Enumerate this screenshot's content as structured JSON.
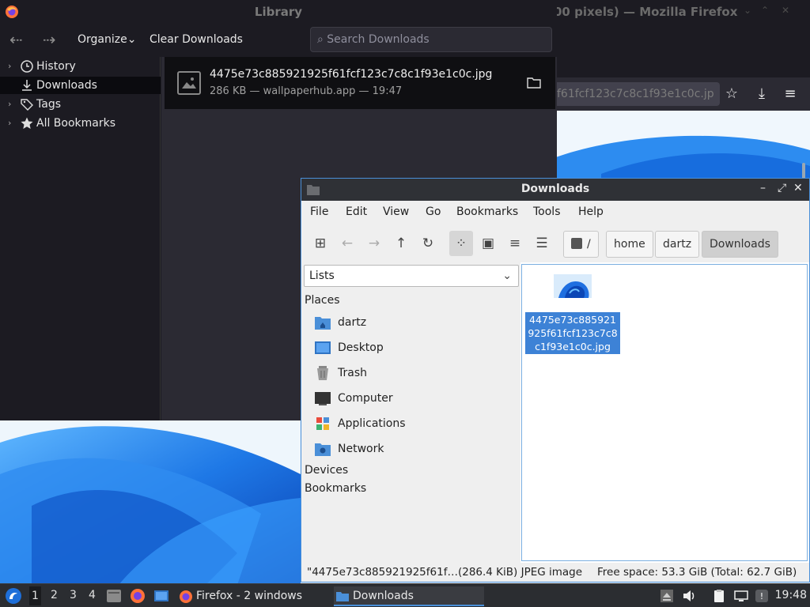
{
  "firefox": {
    "title": "00 pixels) — Mozilla Firefox",
    "url_fragment": "f61fcf123c7c8c1f93e1c0c.jp",
    "controls": [
      "⌄",
      "⌃",
      "✕"
    ]
  },
  "library": {
    "title": "Library",
    "toolbar": {
      "back_icon": "back-arrow-icon",
      "forward_icon": "forward-arrow-icon",
      "organize_label": "Organize",
      "organize_chevron": "⌄",
      "clear_label": "Clear Downloads",
      "search_placeholder": "Search Downloads"
    },
    "sidebar": {
      "items": [
        {
          "label": "History",
          "icon": "clock-icon"
        },
        {
          "label": "Downloads",
          "icon": "download-icon"
        },
        {
          "label": "Tags",
          "icon": "tag-icon"
        },
        {
          "label": "All Bookmarks",
          "icon": "star-icon"
        }
      ]
    },
    "download": {
      "filename": "4475e73c885921925f61fcf123c7c8c1f93e1c0c.jpg",
      "meta": "286 KB — wallpaperhub.app — 19:47"
    }
  },
  "filemanager": {
    "title": "Downloads",
    "menu": [
      "File",
      "Edit",
      "View",
      "Go",
      "Bookmarks",
      "Tools",
      "Help"
    ],
    "breadcrumbs": [
      "/",
      "home",
      "dartz",
      "Downloads"
    ],
    "side_pane_mode": "Lists",
    "places_header": "Places",
    "places": [
      {
        "label": "dartz",
        "icon": "home-folder-icon"
      },
      {
        "label": "Desktop",
        "icon": "desktop-icon"
      },
      {
        "label": "Trash",
        "icon": "trash-icon"
      },
      {
        "label": "Computer",
        "icon": "computer-icon"
      },
      {
        "label": "Applications",
        "icon": "applications-icon"
      },
      {
        "label": "Network",
        "icon": "network-icon"
      }
    ],
    "devices_header": "Devices",
    "bookmarks_header": "Bookmarks",
    "file": {
      "name": "4475e73c885921925f61fcf123c7c8c1f93e1c0c.jpg"
    },
    "status_left": "\"4475e73c885921925f61f…(286.4 KiB) JPEG image",
    "status_right": "Free space: 53.3 GiB (Total: 62.7 GiB)"
  },
  "taskbar": {
    "workspaces": [
      "1",
      "2",
      "3",
      "4"
    ],
    "tasks": [
      {
        "label": "Firefox - 2 windows",
        "icon": "firefox-icon"
      },
      {
        "label": "Downloads",
        "icon": "folder-icon"
      }
    ],
    "clock": "19:48"
  },
  "colors": {
    "accent": "#4a90d9",
    "selection": "#3d82d6",
    "dark_bg": "#1c1b22"
  }
}
